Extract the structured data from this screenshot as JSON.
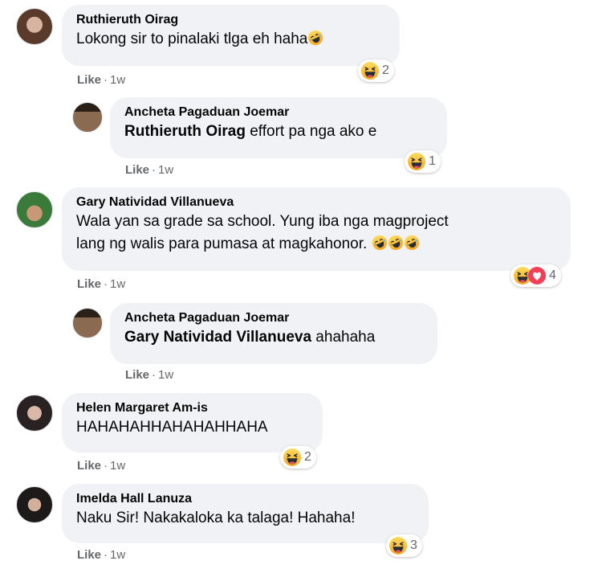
{
  "comments": [
    {
      "author": "Ruthieruth Oirag",
      "text": "Lokong sir to pinalaki tlga eh haha",
      "like": "Like",
      "time": "1w",
      "count": "2"
    },
    {
      "author": "Ancheta Pagaduan Joemar",
      "mention": "Ruthieruth Oirag",
      "text": " effort pa nga ako e",
      "like": "Like",
      "time": "1w",
      "count": "1"
    },
    {
      "author": "Gary Natividad Villanueva",
      "text": "Wala yan sa grade sa school. Yung iba nga magproject\nlang ng walis para pumasa at magkahonor.",
      "like": "Like",
      "time": "1w",
      "count": "4"
    },
    {
      "author": "Ancheta Pagaduan Joemar",
      "mention": "Gary Natividad Villanueva",
      "text": " ahahaha",
      "like": "Like",
      "time": "1w"
    },
    {
      "author": "Helen Margaret Am-is",
      "text": "HAHAHAHHAHAHAHHAHA",
      "like": "Like",
      "time": "1w",
      "count": "2"
    },
    {
      "author": "Imelda Hall Lanuza",
      "text": "Naku Sir! Nakakaloka ka talaga! Hahaha!",
      "like": "Like",
      "time": "1w",
      "count": "3"
    }
  ],
  "icons": {
    "haha": "haha-emoji-icon",
    "rofl": "rofl-emoji-icon",
    "love": "love-heart-icon"
  },
  "colors": {
    "bubble": "#f0f2f5",
    "meta": "#65676b",
    "haha": "#f7b125",
    "love": "#f33e58"
  }
}
